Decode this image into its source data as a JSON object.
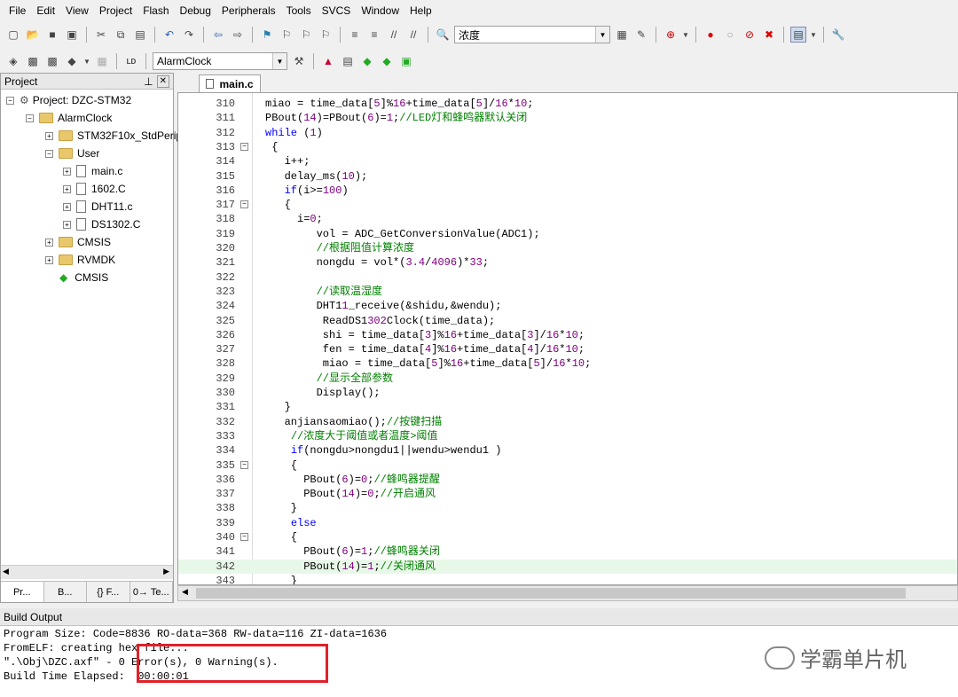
{
  "menu": [
    "File",
    "Edit",
    "View",
    "Project",
    "Flash",
    "Debug",
    "Peripherals",
    "Tools",
    "SVCS",
    "Window",
    "Help"
  ],
  "toolbar": {
    "search_value": "浓度",
    "target": "AlarmClock"
  },
  "project": {
    "title": "Project",
    "root": "Project: DZC-STM32",
    "target": "AlarmClock",
    "groups": [
      "STM32F10x_StdPeriph",
      "User",
      "CMSIS",
      "RVMDK"
    ],
    "files": [
      "main.c",
      "1602.C",
      "DHT11.c",
      "DS1302.C"
    ],
    "cmsis": "CMSIS",
    "tabs": [
      "Pr...",
      "B...",
      "{} F...",
      "0→ Te..."
    ]
  },
  "editor": {
    "tab": "main.c",
    "lines": [
      {
        "n": "310",
        "f": "",
        "t": "miao = time_data[5]%16+time_data[5]/16*10;"
      },
      {
        "n": "311",
        "f": "",
        "t": "PBout(14)=PBout(6)=1;//LED灯和蜂鸣器默认关闭"
      },
      {
        "n": "312",
        "f": "",
        "t": "while (1)"
      },
      {
        "n": "313",
        "f": "−",
        "t": " {"
      },
      {
        "n": "314",
        "f": "",
        "t": "   i++;"
      },
      {
        "n": "315",
        "f": "",
        "t": "   delay_ms(10);"
      },
      {
        "n": "316",
        "f": "",
        "t": "   if(i>=100)"
      },
      {
        "n": "317",
        "f": "−",
        "t": "   {"
      },
      {
        "n": "318",
        "f": "",
        "t": "     i=0;"
      },
      {
        "n": "319",
        "f": "",
        "t": "        vol = ADC_GetConversionValue(ADC1);"
      },
      {
        "n": "320",
        "f": "",
        "t": "        //根据阻值计算浓度"
      },
      {
        "n": "321",
        "f": "",
        "t": "        nongdu = vol*(3.4/4096)*33;"
      },
      {
        "n": "322",
        "f": "",
        "t": ""
      },
      {
        "n": "323",
        "f": "",
        "t": "        //读取温湿度"
      },
      {
        "n": "324",
        "f": "",
        "t": "        DHT11_receive(&shidu,&wendu);"
      },
      {
        "n": "325",
        "f": "",
        "t": "         ReadDS1302Clock(time_data);"
      },
      {
        "n": "326",
        "f": "",
        "t": "         shi = time_data[3]%16+time_data[3]/16*10;"
      },
      {
        "n": "327",
        "f": "",
        "t": "         fen = time_data[4]%16+time_data[4]/16*10;"
      },
      {
        "n": "328",
        "f": "",
        "t": "         miao = time_data[5]%16+time_data[5]/16*10;"
      },
      {
        "n": "329",
        "f": "",
        "t": "        //显示全部参数"
      },
      {
        "n": "330",
        "f": "",
        "t": "        Display();"
      },
      {
        "n": "331",
        "f": "",
        "t": "   }"
      },
      {
        "n": "332",
        "f": "",
        "t": "   anjiansaomiao();//按键扫描"
      },
      {
        "n": "333",
        "f": "",
        "t": "    //浓度大于阈值或者温度>阈值"
      },
      {
        "n": "334",
        "f": "",
        "t": "    if(nongdu>nongdu1||wendu>wendu1 )"
      },
      {
        "n": "335",
        "f": "−",
        "t": "    {"
      },
      {
        "n": "336",
        "f": "",
        "t": "      PBout(6)=0;//蜂鸣器提醒"
      },
      {
        "n": "337",
        "f": "",
        "t": "      PBout(14)=0;//开启通风"
      },
      {
        "n": "338",
        "f": "",
        "t": "    }"
      },
      {
        "n": "339",
        "f": "",
        "t": "    else"
      },
      {
        "n": "340",
        "f": "−",
        "t": "    {"
      },
      {
        "n": "341",
        "f": "",
        "t": "      PBout(6)=1;//蜂鸣器关闭"
      },
      {
        "n": "342",
        "f": "",
        "t": "      PBout(14)=1;//关闭通风"
      },
      {
        "n": "343",
        "f": "",
        "t": "    }"
      }
    ]
  },
  "build": {
    "title": "Build Output",
    "lines": [
      "Program Size: Code=8836 RO-data=368 RW-data=116 ZI-data=1636",
      "FromELF: creating hex file...",
      "\".\\Obj\\DZC.axf\" - 0 Error(s), 0 Warning(s).",
      "Build Time Elapsed:  00:00:01"
    ]
  },
  "watermark": "学霸单片机"
}
